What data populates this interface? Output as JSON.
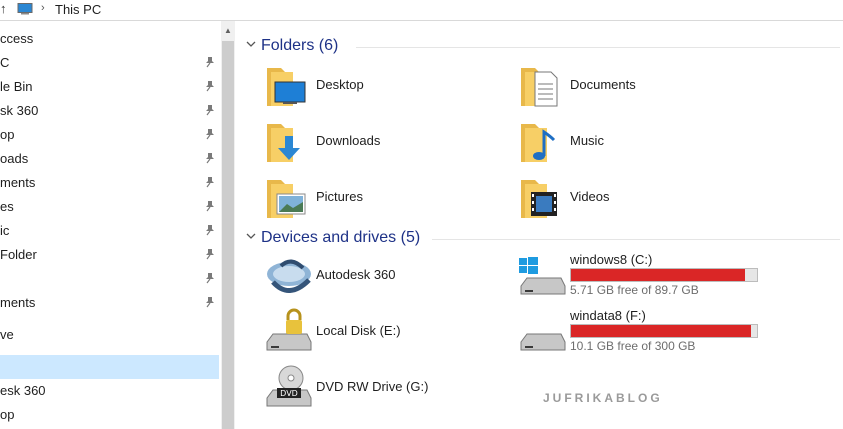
{
  "address_bar": {
    "up_icon": "up-arrow-icon",
    "location_icon": "this-pc-icon",
    "separator": "›",
    "breadcrumb": "This PC"
  },
  "nav_pane": {
    "items": [
      {
        "label": "ccess",
        "pinned": false
      },
      {
        "label": "C",
        "pinned": true
      },
      {
        "label": "le Bin",
        "pinned": true
      },
      {
        "label": "sk 360",
        "pinned": true
      },
      {
        "label": "op",
        "pinned": true
      },
      {
        "label": "oads",
        "pinned": true
      },
      {
        "label": "ments",
        "pinned": true
      },
      {
        "label": "es",
        "pinned": true
      },
      {
        "label": "ic",
        "pinned": true
      },
      {
        "label": " Folder",
        "pinned": true
      },
      {
        "label": "",
        "pinned": true
      },
      {
        "label": "ments",
        "pinned": true
      },
      {
        "label": "ve",
        "pinned": false
      },
      {
        "label": "",
        "pinned": false,
        "selected": true
      },
      {
        "label": "esk 360",
        "pinned": false
      },
      {
        "label": "op",
        "pinned": false
      }
    ]
  },
  "content": {
    "folders_header": "Folders (6)",
    "folders": [
      {
        "name": "Desktop",
        "icon": "desktop-folder-icon"
      },
      {
        "name": "Documents",
        "icon": "documents-folder-icon"
      },
      {
        "name": "Downloads",
        "icon": "downloads-folder-icon"
      },
      {
        "name": "Music",
        "icon": "music-folder-icon"
      },
      {
        "name": "Pictures",
        "icon": "pictures-folder-icon"
      },
      {
        "name": "Videos",
        "icon": "videos-folder-icon"
      }
    ],
    "devices_header": "Devices and drives (5)",
    "devices": [
      {
        "name": "Autodesk 360",
        "icon": "autodesk-360-icon"
      },
      {
        "name": "windows8 (C:)",
        "icon": "windows-drive-icon",
        "free_text": "5.71 GB free of 89.7 GB",
        "used_fraction": 0.936
      },
      {
        "name": "Local Disk (E:)",
        "icon": "locked-drive-icon"
      },
      {
        "name": "windata8 (F:)",
        "icon": "hard-drive-icon",
        "free_text": "10.1 GB free of 300 GB",
        "used_fraction": 0.966
      },
      {
        "name": "DVD RW Drive (G:)",
        "icon": "dvd-drive-icon"
      }
    ]
  },
  "watermark": "JUFRIKABLOG",
  "colors": {
    "accent_header": "#1e3287",
    "bar_fill": "#da2626",
    "selection": "#cce8ff",
    "folder_yellow": "#f7cf66"
  }
}
